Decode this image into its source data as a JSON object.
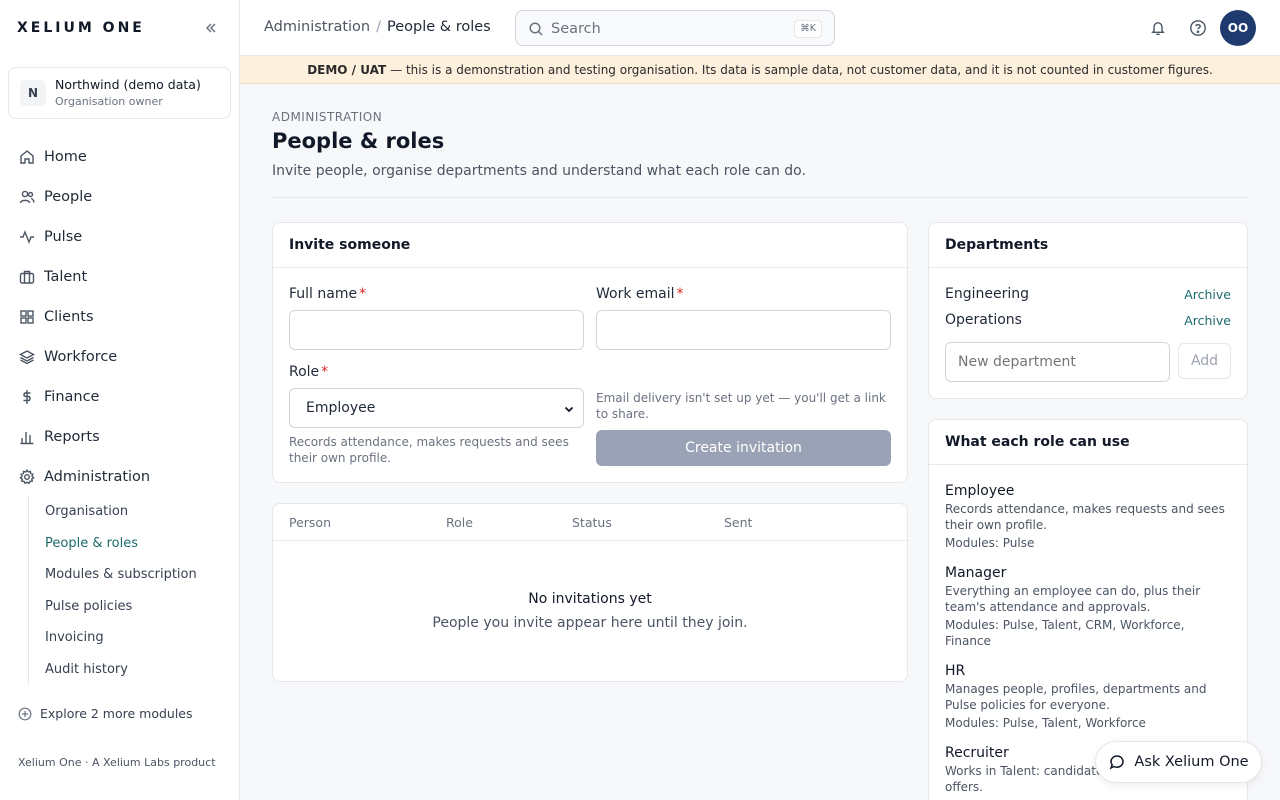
{
  "app": {
    "brand": "XELIUM ONE",
    "footer": "Xelium One · A Xelium Labs product"
  },
  "org": {
    "initial": "N",
    "name": "Northwind (demo data)",
    "role": "Organisation owner"
  },
  "sidebar": {
    "items": [
      {
        "label": "Home",
        "icon": "home-icon"
      },
      {
        "label": "People",
        "icon": "people-icon"
      },
      {
        "label": "Pulse",
        "icon": "pulse-icon"
      },
      {
        "label": "Talent",
        "icon": "briefcase-icon"
      },
      {
        "label": "Clients",
        "icon": "grid-icon"
      },
      {
        "label": "Workforce",
        "icon": "layers-icon"
      },
      {
        "label": "Finance",
        "icon": "dollar-icon"
      },
      {
        "label": "Reports",
        "icon": "bar-chart-icon"
      },
      {
        "label": "Administration",
        "icon": "gear-icon"
      }
    ],
    "subitems": [
      {
        "label": "Organisation"
      },
      {
        "label": "People & roles",
        "active": true
      },
      {
        "label": "Modules & subscription"
      },
      {
        "label": "Pulse policies"
      },
      {
        "label": "Invoicing"
      },
      {
        "label": "Audit history"
      }
    ],
    "explore": "Explore 2 more modules"
  },
  "topbar": {
    "breadcrumb": [
      "Administration",
      "People & roles"
    ],
    "search_placeholder": "Search",
    "search_shortcut": "⌘K",
    "avatar_initials": "OO"
  },
  "banner": {
    "tag": "DEMO / UAT",
    "text": "— this is a demonstration and testing organisation. Its data is sample data, not customer data, and it is not counted in customer figures."
  },
  "page": {
    "eyebrow": "ADMINISTRATION",
    "title": "People & roles",
    "subtitle": "Invite people, organise departments and understand what each role can do."
  },
  "invite": {
    "title": "Invite someone",
    "full_name_label": "Full name",
    "full_name_value": "",
    "work_email_label": "Work email",
    "work_email_value": "",
    "role_label": "Role",
    "role_value": "Employee",
    "role_help": "Records attendance, makes requests and sees their own profile.",
    "email_note": "Email delivery isn't set up yet — you'll get a link to share.",
    "create_button": "Create invitation",
    "required_mark": "*"
  },
  "invitations": {
    "columns": [
      "Person",
      "Role",
      "Status",
      "Sent"
    ],
    "empty_title": "No invitations yet",
    "empty_sub": "People you invite appear here until they join."
  },
  "departments": {
    "title": "Departments",
    "items": [
      {
        "name": "Engineering",
        "action": "Archive"
      },
      {
        "name": "Operations",
        "action": "Archive"
      }
    ],
    "new_placeholder": "New department",
    "add_button": "Add"
  },
  "roles": {
    "title": "What each role can use",
    "items": [
      {
        "name": "Employee",
        "desc": "Records attendance, makes requests and sees their own profile.",
        "modules": "Modules: Pulse"
      },
      {
        "name": "Manager",
        "desc": "Everything an employee can do, plus their team's attendance and approvals.",
        "modules": "Modules: Pulse, Talent, CRM, Workforce, Finance"
      },
      {
        "name": "HR",
        "desc": "Manages people, profiles, departments and Pulse policies for everyone.",
        "modules": "Modules: Pulse, Talent, Workforce"
      },
      {
        "name": "Recruiter",
        "desc": "Works in Talent: candidates, interviews and offers.",
        "modules": ""
      }
    ]
  },
  "assistant": {
    "label": "Ask Xelium One"
  }
}
